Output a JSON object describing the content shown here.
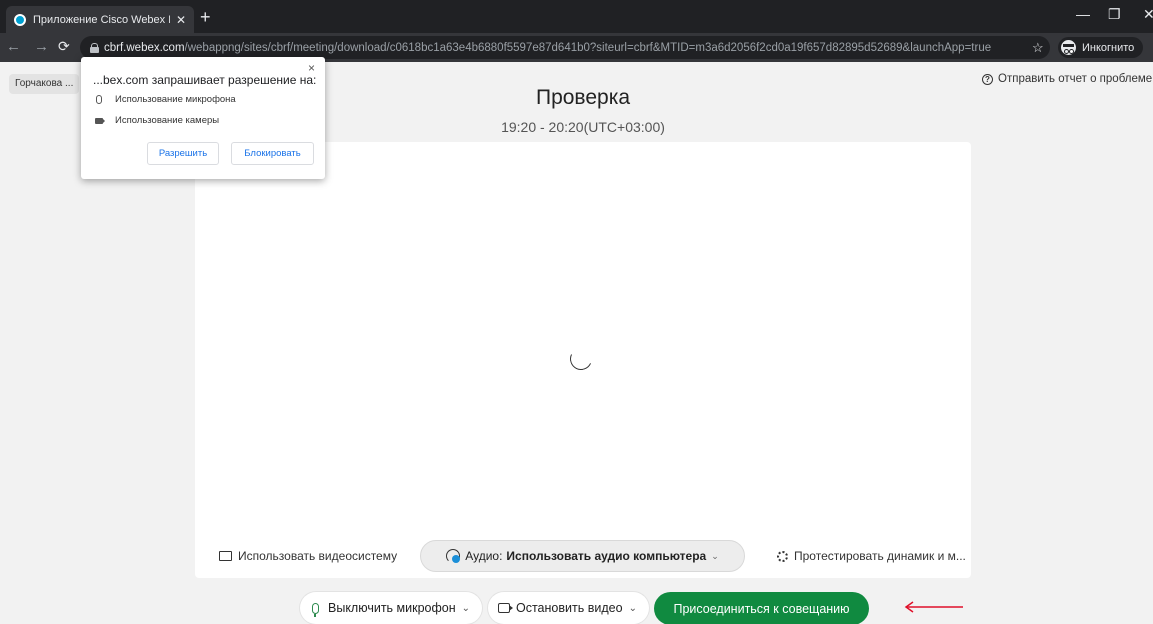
{
  "browser": {
    "tab_title": "Приложение Cisco Webex Meeti",
    "tab_close": "✕",
    "new_tab": "+",
    "url_domain": "cbrf.webex.com",
    "url_path": "/webappng/sites/cbrf/meeting/download/c0618bc1a63e4b6880f5597e87d641b0?siteurl=cbrf&MTID=m3a6d2056f2cd0a19f657d82895d52689&launchApp=true",
    "incognito_label": "Инкогнито",
    "icons": [
      "favicon-icon",
      "back-icon",
      "forward-icon",
      "reload-icon",
      "lock-icon",
      "star-icon",
      "incognito-icon",
      "menu-icon",
      "minimize-icon",
      "restore-icon",
      "close-icon"
    ]
  },
  "bookmark": {
    "label": "Горчакова ..."
  },
  "permission_popup": {
    "title": "...bex.com запрашивает разрешение на:",
    "close": "×",
    "items": [
      {
        "icon": "mic-icon",
        "label": "Использование микрофона"
      },
      {
        "icon": "camera-icon",
        "label": "Использование камеры"
      }
    ],
    "allow_label": "Разрешить",
    "block_label": "Блокировать"
  },
  "report_link": "Отправить отчет о проблеме",
  "meeting": {
    "title": "Проверка",
    "time": "19:20 - 20:20(UTC+03:00)"
  },
  "preview": {
    "use_video_system": "Использовать видеосистему",
    "audio_prefix": "Аудио:",
    "audio_value": "Использовать аудио компьютера",
    "test_speaker": "Протестировать динамик и м..."
  },
  "controls": {
    "mute_label": "Выключить микрофон",
    "stop_video_label": "Остановить видео",
    "join_label": "Присоединиться к совещанию",
    "chevron": "⌄"
  },
  "colors": {
    "join_button": "#108a40",
    "annotation_arrow": "#e0102a"
  }
}
